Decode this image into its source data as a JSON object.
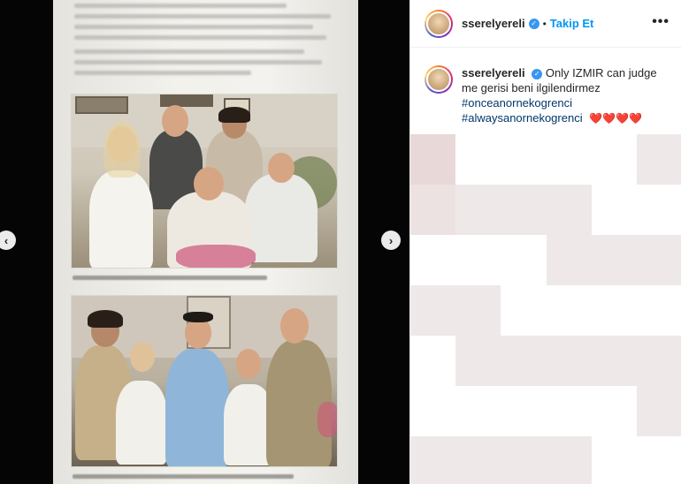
{
  "post": {
    "username": "sserelyereli",
    "follow_label": "Takip Et",
    "separator": "•",
    "more_label": "•••",
    "verified_glyph": "✓"
  },
  "caption": {
    "username": "sserelyereli",
    "text": "Only IZMIR can judge me gerisi beni ilgilendirmez",
    "hashtags": [
      "#onceanornekogrenci",
      "#alwaysanornekogrenci"
    ],
    "emoji": "❤️❤️❤️❤️"
  },
  "nav": {
    "prev_icon": "chevron-left-icon",
    "next_icon": "chevron-right-icon",
    "prev_glyph": "‹",
    "next_glyph": "›"
  },
  "colors": {
    "accent": "#0095f6",
    "verified": "#3897f0",
    "hashtag": "#00376b",
    "text": "#262626"
  }
}
